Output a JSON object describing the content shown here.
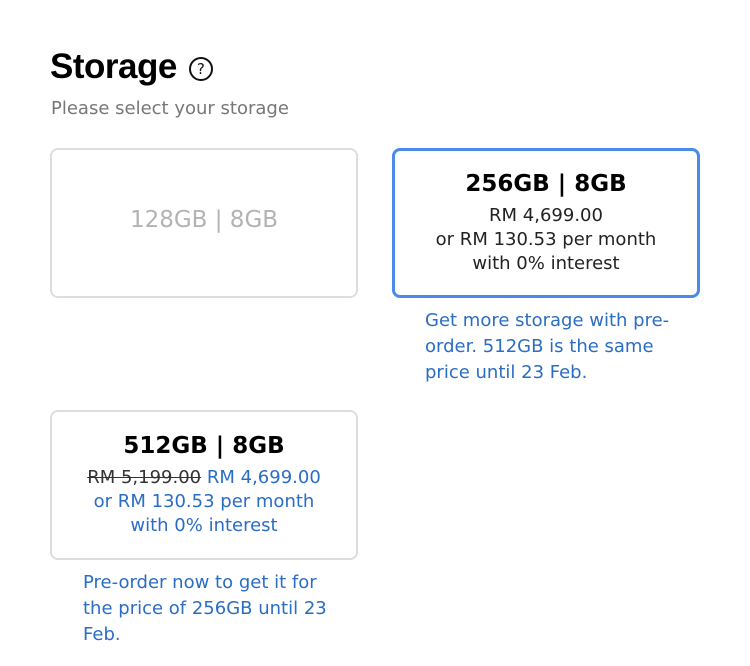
{
  "header": {
    "title": "Storage",
    "help_glyph": "?",
    "subtitle": "Please select your storage"
  },
  "options": [
    {
      "capacity": "128GB | 8GB",
      "state": "disabled"
    },
    {
      "capacity": "256GB | 8GB",
      "state": "selected",
      "price": "RM 4,699.00",
      "monthly": "or RM 130.53 per month",
      "interest": "with 0% interest",
      "promo_lines": [
        "Get more storage with pre-",
        "order. 512GB is the same",
        "price until 23 Feb."
      ]
    },
    {
      "capacity": "512GB | 8GB",
      "state": "available",
      "original_price": "RM 5,199.00",
      "price": "RM 4,699.00",
      "monthly": "or RM 130.53 per month",
      "interest": "with 0% interest",
      "promo_lines": [
        "Pre-order now to get it for",
        "the price of 256GB until 23",
        "Feb."
      ]
    }
  ],
  "colors": {
    "selected_border": "#4a8ae8",
    "promo_text": "#2a6dc4",
    "card_border": "#dddddd",
    "subtitle_text": "#777777"
  }
}
